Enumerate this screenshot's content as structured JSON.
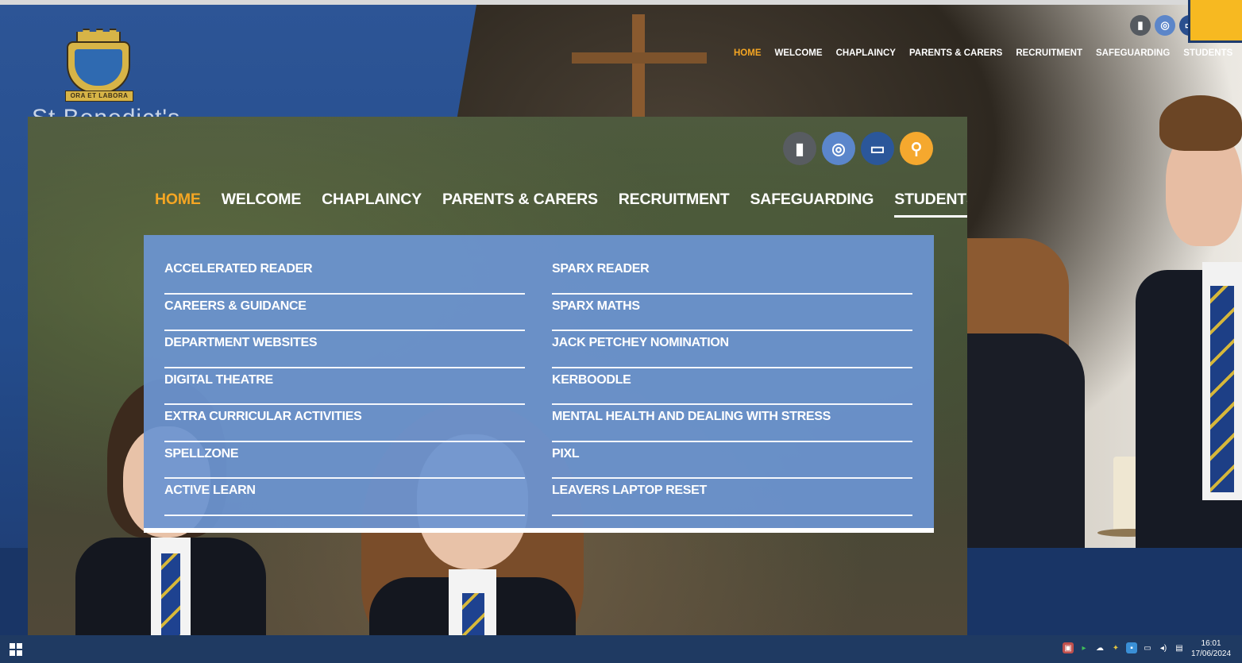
{
  "site": {
    "logo_motto": "ORA ET LABORA",
    "site_name_partial": "St Benedict's",
    "nav": [
      "HOME",
      "WELCOME",
      "CHAPLAINCY",
      "PARENTS & CARERS",
      "RECRUITMENT",
      "SAFEGUARDING",
      "STUDENTS"
    ],
    "active_nav": "HOME",
    "social_icons": [
      "office-icon",
      "instagram-icon",
      "contact-card-icon"
    ]
  },
  "zoom": {
    "nav": [
      "HOME",
      "WELCOME",
      "CHAPLAINCY",
      "PARENTS & CARERS",
      "RECRUITMENT",
      "SAFEGUARDING",
      "STUDENTS"
    ],
    "active_nav": "HOME",
    "current_menu": "STUDENTS",
    "icons": [
      "office-icon",
      "instagram-icon",
      "contact-card-icon",
      "search-icon"
    ],
    "dropdown": {
      "left": [
        "ACCELERATED READER",
        "CAREERS & GUIDANCE",
        "DEPARTMENT WEBSITES",
        "DIGITAL THEATRE",
        "EXTRA CURRICULAR ACTIVITIES",
        "SPELLZONE",
        "ACTIVE LEARN"
      ],
      "right": [
        "SPARX READER",
        "SPARX MATHS",
        "JACK PETCHEY NOMINATION",
        "KERBOODLE",
        "MENTAL HEALTH AND DEALING WITH STRESS",
        "PIXL",
        "LEAVERS LAPTOP RESET"
      ]
    }
  },
  "colors": {
    "accent_orange": "#f5a623",
    "brand_blue": "#2b5294",
    "dropdown_blue": "#6c94d2"
  },
  "taskbar": {
    "time": "16:01",
    "date": "17/06/2024"
  }
}
